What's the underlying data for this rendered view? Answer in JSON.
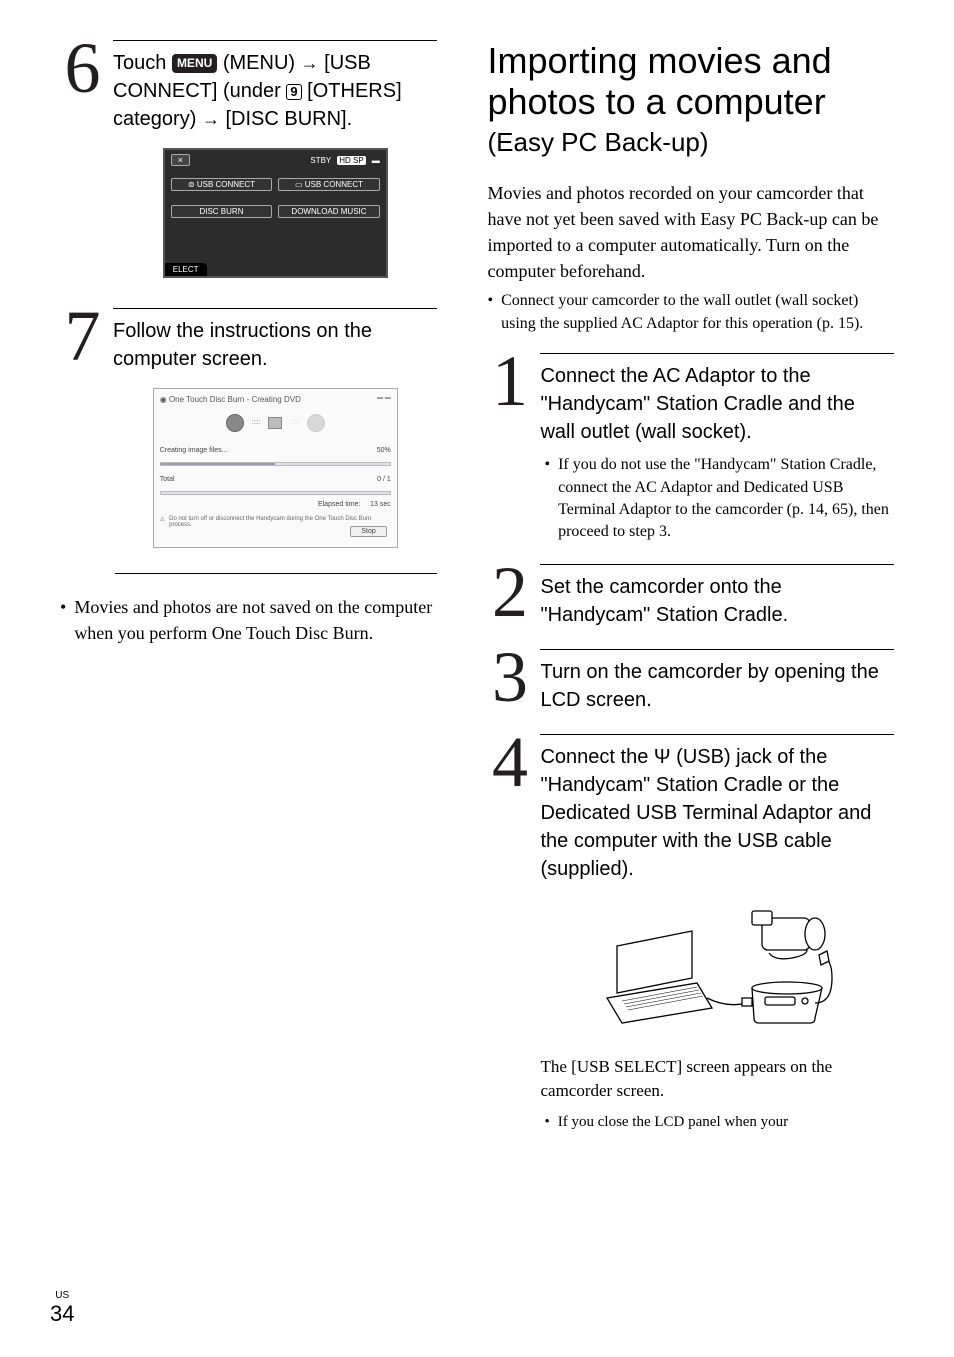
{
  "leftCol": {
    "step6": {
      "num": "6",
      "textPart1": "Touch ",
      "menuLabel": "MENU",
      "textPart2": " (MENU) ",
      "arrow1": "→",
      "textPart3": " [USB CONNECT] (under ",
      "sqNum": "9",
      "textPart4": " [OTHERS] category) ",
      "arrow2": "→",
      "textPart5": " [DISC BURN]."
    },
    "screenshot1": {
      "close": "×",
      "stby": "STBY",
      "hdsp": "HD SP",
      "usb1": "⊜ USB CONNECT",
      "usb2": "▭ USB CONNECT",
      "disc": "DISC BURN",
      "download": "DOWNLOAD MUSIC",
      "select": "ELECT"
    },
    "step7": {
      "num": "7",
      "text": "Follow the instructions on the computer screen."
    },
    "screenshot2": {
      "title": "One Touch Disc Burn - Creating DVD",
      "creating": "Creating image files...",
      "pct": "50%",
      "total": "Total",
      "totalVal": "0 / 1",
      "elapsed": "Elapsed time:",
      "elapsedVal": "13 sec",
      "warn": "Do not turn off or disconnect the Handycam during the One Touch Disc Burn process.",
      "stop": "Stop"
    },
    "note1": "Movies and photos are not saved on the computer when you perform One Touch Disc Burn."
  },
  "rightCol": {
    "title": "Importing movies and photos to a computer",
    "subtitle": "(Easy PC Back-up)",
    "intro": "Movies and photos recorded on your camcorder that have not yet been saved with Easy PC Back-up can be imported to a computer automatically. Turn on the computer beforehand.",
    "introBullet": "Connect your camcorder to the wall outlet (wall socket) using the supplied AC Adaptor for this operation (p. 15).",
    "step1": {
      "num": "1",
      "text": "Connect the AC Adaptor to the \"Handycam\" Station Cradle and the wall outlet (wall socket).",
      "sub": "If you do not use the \"Handycam\" Station Cradle, connect the AC Adaptor and Dedicated USB Terminal Adaptor to the camcorder (p. 14, 65), then proceed to step 3."
    },
    "step2": {
      "num": "2",
      "text": "Set the camcorder onto the \"Handycam\" Station Cradle."
    },
    "step3": {
      "num": "3",
      "text": "Turn on the camcorder by opening the LCD screen."
    },
    "step4": {
      "num": "4",
      "textA": "Connect the ",
      "textB": " (USB) jack of the \"Handycam\" Station Cradle or the Dedicated USB Terminal Adaptor and the computer with the USB cable (supplied)."
    },
    "afterDiagram": "The [USB SELECT] screen appears on the camcorder screen.",
    "afterBullet": "If you close the LCD panel when your"
  },
  "footer": {
    "region": "US",
    "page": "34"
  }
}
